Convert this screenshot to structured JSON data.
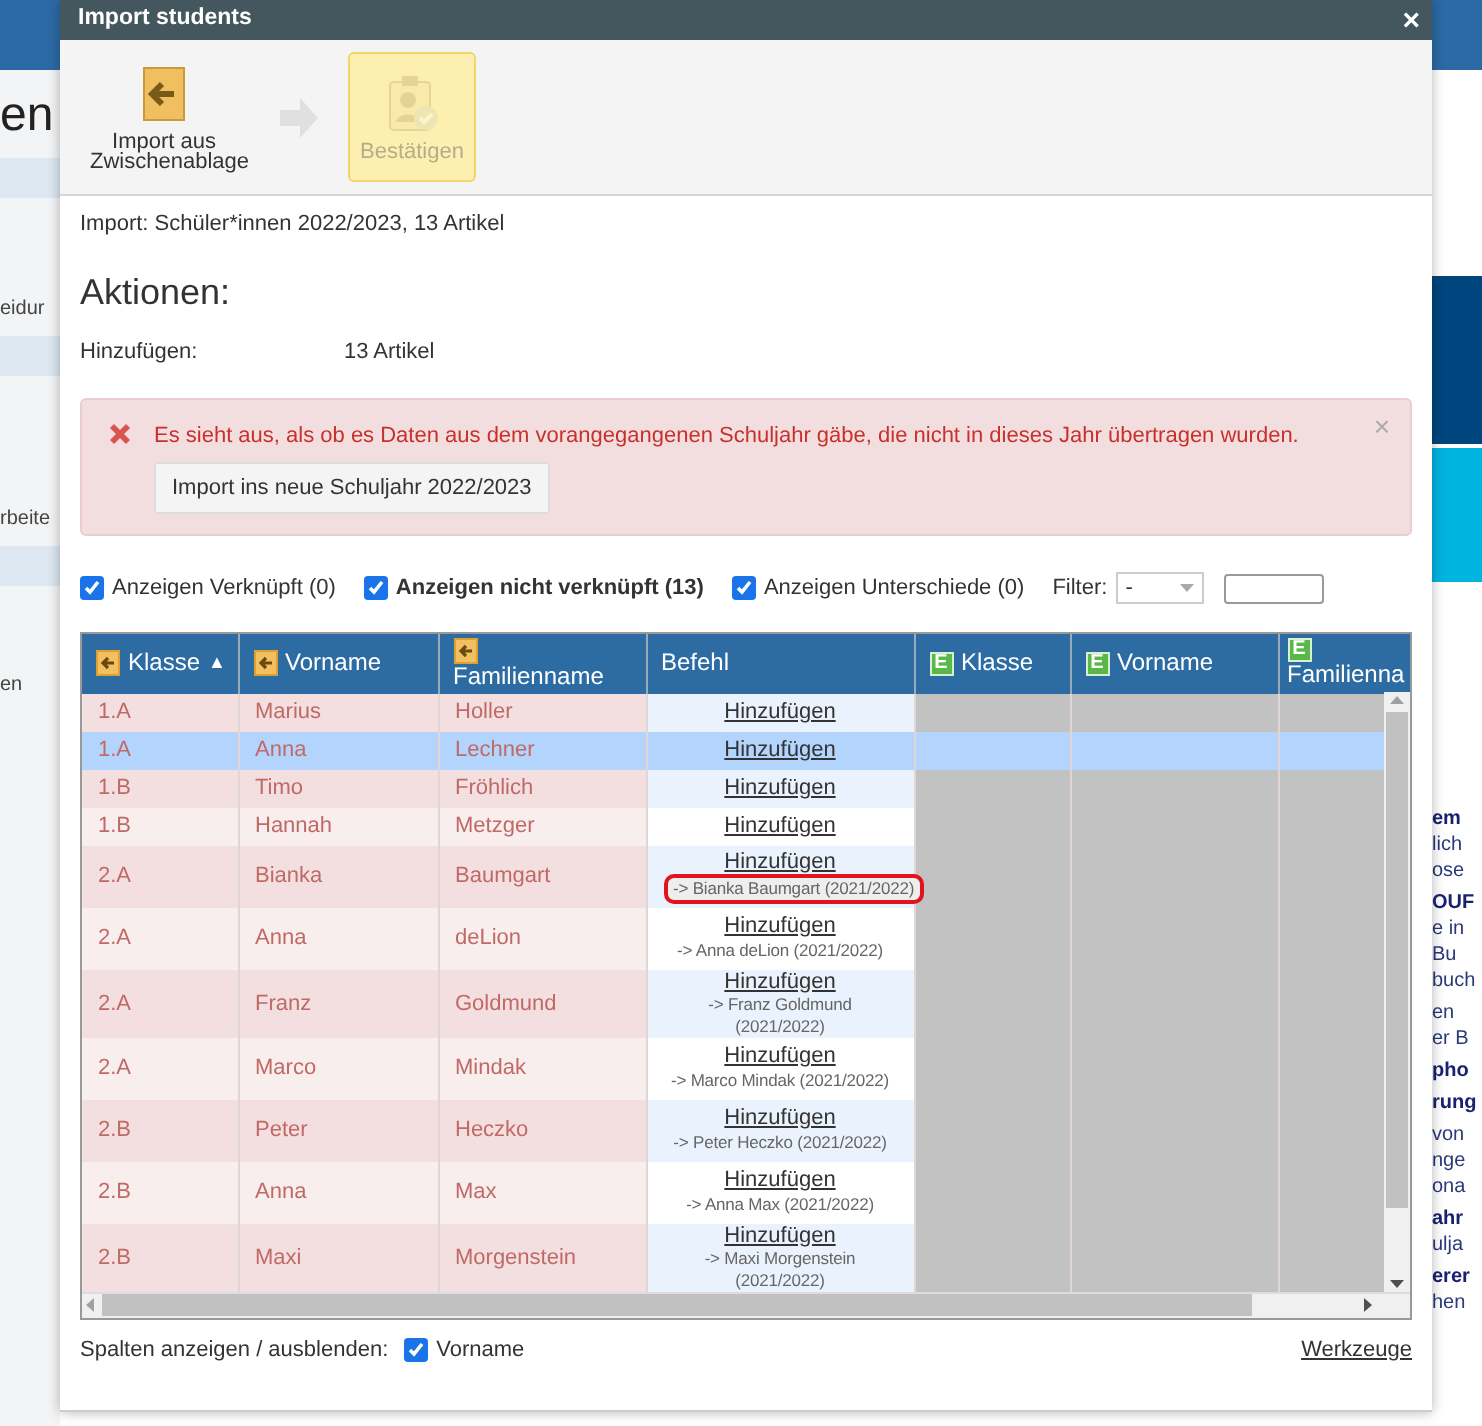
{
  "background": {
    "left_fragments": [
      {
        "text": "en",
        "kind": "heading"
      },
      {
        "text": "eidur",
        "kind": "text"
      },
      {
        "text": "rbeite",
        "kind": "text"
      },
      {
        "text": "en",
        "kind": "text"
      }
    ],
    "right_groups": [
      [
        {
          "text": "em",
          "bold": true
        },
        {
          "text": "lich",
          "bold": false
        },
        {
          "text": "ose",
          "bold": false
        }
      ],
      [
        {
          "text": "OUF",
          "bold": true
        },
        {
          "text": "e in",
          "bold": false
        },
        {
          "text": "Bu",
          "bold": false
        },
        {
          "text": "buch",
          "bold": false
        }
      ],
      [
        {
          "text": "en",
          "bold": false
        },
        {
          "text": "er B",
          "bold": false
        }
      ],
      [
        {
          "text": "pho",
          "bold": true
        }
      ],
      [
        {
          "text": "rung",
          "bold": true
        }
      ],
      [
        {
          "text": "von",
          "bold": false
        },
        {
          "text": "nge",
          "bold": false
        },
        {
          "text": "ona",
          "bold": false
        }
      ],
      [
        {
          "text": "ahr",
          "bold": true
        },
        {
          "text": "ulja",
          "bold": false
        }
      ],
      [
        {
          "text": "erer",
          "bold": true
        },
        {
          "text": "hen",
          "bold": false
        }
      ]
    ]
  },
  "dialog": {
    "title": "Import students",
    "close": "×",
    "toolbar": [
      {
        "kind": "button",
        "label": "Import aus Zwischenablage",
        "current": false,
        "disabled": false
      },
      {
        "kind": "arrow"
      },
      {
        "kind": "button",
        "label": "Bestätigen",
        "current": true,
        "disabled": true
      }
    ],
    "import_info": "Import: Schüler*innen 2022/2023, 13 Artikel",
    "actions_heading": "Aktionen:",
    "actions": [
      {
        "label": "Hinzufügen:",
        "value": "13 Artikel"
      }
    ],
    "alert": {
      "message": "Es sieht aus, als ob es Daten aus dem vorangegangenen Schuljahr gäbe, die nicht in dieses Jahr übertragen wurden.",
      "button": "Import ins neue Schuljahr 2022/2023",
      "close": "×"
    },
    "filters": [
      {
        "label": "Anzeigen Verknüpft (0)",
        "checked": true,
        "bold": false
      },
      {
        "label": "Anzeigen nicht verknüpft (13)",
        "checked": true,
        "bold": true
      },
      {
        "label": "Anzeigen Unterschiede (0)",
        "checked": true,
        "bold": false
      }
    ],
    "filter": {
      "label": "Filter:",
      "value": "-"
    },
    "table": {
      "columns": [
        {
          "label": "Klasse",
          "kind": "import",
          "sort_mark": "▲"
        },
        {
          "label": "Vorname",
          "kind": "import"
        },
        {
          "label": "Familienname",
          "kind": "import"
        },
        {
          "label": "Befehl",
          "kind": "plain"
        },
        {
          "label": "Klasse",
          "kind": "existing",
          "icon_text": "E"
        },
        {
          "label": "Vorname",
          "kind": "existing",
          "icon_text": "E"
        },
        {
          "label": "Familienna",
          "kind": "existing",
          "icon_text": "E"
        }
      ],
      "rows": [
        {
          "klasse": "1.A",
          "vorname": "Marius",
          "familienname": "Holler",
          "action": "Hinzufügen",
          "selected": false
        },
        {
          "klasse": "1.A",
          "vorname": "Anna",
          "familienname": "Lechner",
          "action": "Hinzufügen",
          "selected": true
        },
        {
          "klasse": "1.B",
          "vorname": "Timo",
          "familienname": "Fröhlich",
          "action": "Hinzufügen",
          "selected": false
        },
        {
          "klasse": "1.B",
          "vorname": "Hannah",
          "familienname": "Metzger",
          "action": "Hinzufügen",
          "selected": false
        },
        {
          "klasse": "2.A",
          "vorname": "Bianka",
          "familienname": "Baumgart",
          "action": "Hinzufügen",
          "note": "-> Bianka Baumgart (2021/2022)",
          "outlined": true,
          "selected": false
        },
        {
          "klasse": "2.A",
          "vorname": "Anna",
          "familienname": "deLion",
          "action": "Hinzufügen",
          "note": "-> Anna deLion (2021/2022)",
          "selected": false
        },
        {
          "klasse": "2.A",
          "vorname": "Franz",
          "familienname": "Goldmund",
          "action": "Hinzufügen",
          "note": "-> Franz Goldmund (2021/2022)",
          "selected": false
        },
        {
          "klasse": "2.A",
          "vorname": "Marco",
          "familienname": "Mindak",
          "action": "Hinzufügen",
          "note": "-> Marco Mindak (2021/2022)",
          "selected": false
        },
        {
          "klasse": "2.B",
          "vorname": "Peter",
          "familienname": "Heczko",
          "action": "Hinzufügen",
          "note": "-> Peter Heczko (2021/2022)",
          "selected": false
        },
        {
          "klasse": "2.B",
          "vorname": "Anna",
          "familienname": "Max",
          "action": "Hinzufügen",
          "note": "-> Anna Max (2021/2022)",
          "selected": false
        },
        {
          "klasse": "2.B",
          "vorname": "Maxi",
          "familienname": "Morgenstein",
          "action": "Hinzufügen",
          "note": "-> Maxi Morgenstein (2021/2022)",
          "selected": false
        }
      ]
    },
    "columns_toggle": {
      "label": "Spalten anzeigen / ausblenden:",
      "options": [
        {
          "label": "Vorname",
          "checked": true
        }
      ]
    },
    "tools_link": "Werkzeuge"
  }
}
